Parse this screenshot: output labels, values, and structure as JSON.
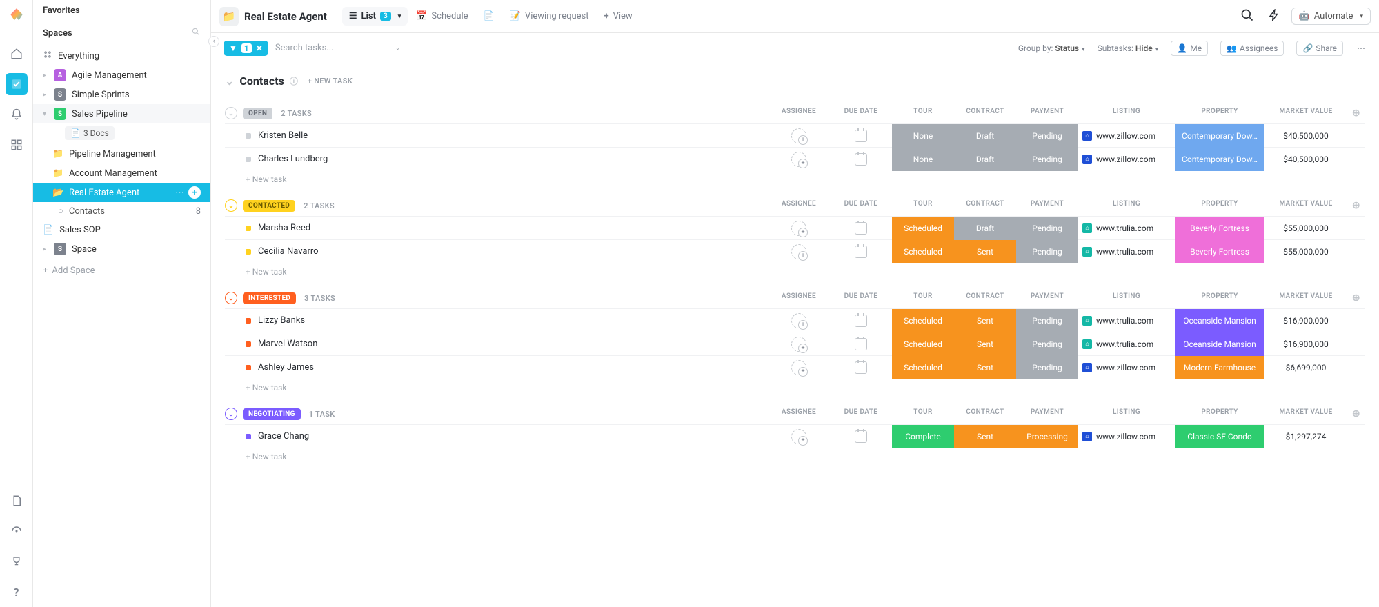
{
  "sidebar": {
    "favorites": "Favorites",
    "spaces": "Spaces",
    "everything": "Everything",
    "items": [
      {
        "label": "Agile Management",
        "color": "#b660e0",
        "initial": "A"
      },
      {
        "label": "Simple Sprints",
        "color": "#7c828d",
        "initial": "S"
      },
      {
        "label": "Sales Pipeline",
        "color": "#2ecd6f",
        "initial": "S",
        "expanded": true,
        "docs": "3 Docs",
        "folders": [
          {
            "label": "Pipeline Management"
          },
          {
            "label": "Account Management"
          },
          {
            "label": "Real Estate Agent",
            "active": true,
            "lists": [
              {
                "label": "Contacts",
                "count": "8"
              }
            ]
          }
        ]
      },
      {
        "label": "Sales SOP",
        "type": "doc"
      },
      {
        "label": "Space",
        "color": "#7c828d",
        "initial": "S"
      }
    ],
    "addspace": "Add Space"
  },
  "header": {
    "title": "Real Estate Agent",
    "views": [
      {
        "label": "List",
        "badge": "3",
        "active": true,
        "icon": "list"
      },
      {
        "label": "Schedule",
        "icon": "calendar"
      },
      {
        "label": "",
        "icon": "doc"
      },
      {
        "label": "Viewing request",
        "icon": "form"
      },
      {
        "label": "View",
        "icon": "plus"
      }
    ],
    "automate": "Automate"
  },
  "toolbar": {
    "filter_count": "1",
    "search_placeholder": "Search tasks...",
    "groupby_label": "Group by:",
    "groupby_value": "Status",
    "subtasks_label": "Subtasks:",
    "subtasks_value": "Hide",
    "me": "Me",
    "assignees": "Assignees",
    "share": "Share"
  },
  "section": {
    "title": "Contacts",
    "newtask": "+ NEW TASK"
  },
  "columns": {
    "assignee": "ASSIGNEE",
    "due": "DUE DATE",
    "tour": "TOUR",
    "contract": "CONTRACT",
    "payment": "PAYMENT",
    "listing": "LISTING",
    "property": "PROPERTY",
    "value": "MARKET VALUE"
  },
  "colors": {
    "grey": "#a6acb3",
    "orange": "#f7931e",
    "green": "#2ecd6f",
    "blue": "#6fa8ef",
    "pink": "#ef6fd9",
    "violet": "#7b5cff",
    "darkorange": "#f7931e"
  },
  "groups": [
    {
      "status": "OPEN",
      "pillbg": "#cfd3d8",
      "pilltext": "#6a6f78",
      "toggle": "#cfd3d8",
      "count": "2 TASKS",
      "bullet": "#cfd3d8",
      "rows": [
        {
          "name": "Kristen Belle",
          "tour": {
            "t": "None",
            "c": "#a6acb3"
          },
          "contract": {
            "t": "Draft",
            "c": "#a6acb3"
          },
          "payment": {
            "t": "Pending",
            "c": "#a6acb3"
          },
          "listing": {
            "t": "www.zillow.com",
            "c": "#1f4fd6"
          },
          "property": {
            "t": "Contemporary Dow…",
            "c": "#6fa8ef"
          },
          "value": "$40,500,000"
        },
        {
          "name": "Charles Lundberg",
          "tour": {
            "t": "None",
            "c": "#a6acb3"
          },
          "contract": {
            "t": "Draft",
            "c": "#a6acb3"
          },
          "payment": {
            "t": "Pending",
            "c": "#a6acb3"
          },
          "listing": {
            "t": "www.zillow.com",
            "c": "#1f4fd6"
          },
          "property": {
            "t": "Contemporary Dow…",
            "c": "#6fa8ef"
          },
          "value": "$40,500,000"
        }
      ]
    },
    {
      "status": "CONTACTED",
      "pillbg": "#ffd21f",
      "pilltext": "#6b5b00",
      "toggle": "#ffd21f",
      "count": "2 TASKS",
      "bullet": "#ffd21f",
      "rows": [
        {
          "name": "Marsha Reed",
          "tour": {
            "t": "Scheduled",
            "c": "#f7931e"
          },
          "contract": {
            "t": "Draft",
            "c": "#a6acb3"
          },
          "payment": {
            "t": "Pending",
            "c": "#a6acb3"
          },
          "listing": {
            "t": "www.trulia.com",
            "c": "#14b8a6"
          },
          "property": {
            "t": "Beverly Fortress",
            "c": "#ef6fd9"
          },
          "value": "$55,000,000"
        },
        {
          "name": "Cecilia Navarro",
          "tour": {
            "t": "Scheduled",
            "c": "#f7931e"
          },
          "contract": {
            "t": "Sent",
            "c": "#f7931e"
          },
          "payment": {
            "t": "Pending",
            "c": "#a6acb3"
          },
          "listing": {
            "t": "www.trulia.com",
            "c": "#14b8a6"
          },
          "property": {
            "t": "Beverly Fortress",
            "c": "#ef6fd9"
          },
          "value": "$55,000,000"
        }
      ]
    },
    {
      "status": "INTERESTED",
      "pillbg": "#ff5f1f",
      "pilltext": "#ffffff",
      "toggle": "#ff5f1f",
      "count": "3 TASKS",
      "bullet": "#ff5f1f",
      "rows": [
        {
          "name": "Lizzy Banks",
          "tour": {
            "t": "Scheduled",
            "c": "#f7931e"
          },
          "contract": {
            "t": "Sent",
            "c": "#f7931e"
          },
          "payment": {
            "t": "Pending",
            "c": "#a6acb3"
          },
          "listing": {
            "t": "www.trulia.com",
            "c": "#14b8a6"
          },
          "property": {
            "t": "Oceanside Mansion",
            "c": "#7b5cff"
          },
          "value": "$16,900,000"
        },
        {
          "name": "Marvel Watson",
          "tour": {
            "t": "Scheduled",
            "c": "#f7931e"
          },
          "contract": {
            "t": "Sent",
            "c": "#f7931e"
          },
          "payment": {
            "t": "Pending",
            "c": "#a6acb3"
          },
          "listing": {
            "t": "www.trulia.com",
            "c": "#14b8a6"
          },
          "property": {
            "t": "Oceanside Mansion",
            "c": "#7b5cff"
          },
          "value": "$16,900,000"
        },
        {
          "name": "Ashley James",
          "tour": {
            "t": "Scheduled",
            "c": "#f7931e"
          },
          "contract": {
            "t": "Sent",
            "c": "#f7931e"
          },
          "payment": {
            "t": "Pending",
            "c": "#a6acb3"
          },
          "listing": {
            "t": "www.zillow.com",
            "c": "#1f4fd6"
          },
          "property": {
            "t": "Modern Farmhouse",
            "c": "#f7931e"
          },
          "value": "$6,699,000"
        }
      ]
    },
    {
      "status": "NEGOTIATING",
      "pillbg": "#7b5cff",
      "pilltext": "#ffffff",
      "toggle": "#7b5cff",
      "count": "1 TASK",
      "bullet": "#7b5cff",
      "rows": [
        {
          "name": "Grace Chang",
          "tour": {
            "t": "Complete",
            "c": "#2ecd6f"
          },
          "contract": {
            "t": "Sent",
            "c": "#f7931e"
          },
          "payment": {
            "t": "Processing",
            "c": "#f7931e"
          },
          "listing": {
            "t": "www.zillow.com",
            "c": "#1f4fd6"
          },
          "property": {
            "t": "Classic SF Condo",
            "c": "#2ecd6f"
          },
          "value": "$1,297,274"
        }
      ]
    }
  ],
  "newtask_row": "+ New task"
}
